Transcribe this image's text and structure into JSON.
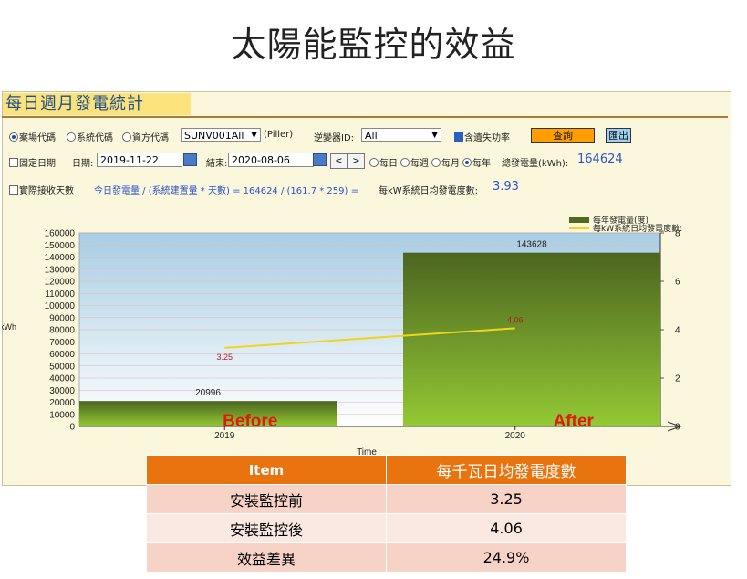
{
  "slide_title": "太陽能監控的效益",
  "panel_title": "每日週月發電統計",
  "controls": {
    "radio_station": "案場代碼",
    "radio_system": "系統代碼",
    "radio_owner": "資方代碼",
    "station_select": "SUNV001All",
    "station_note": "(Piller)",
    "inverter_label": "逆變器ID:",
    "inverter_select": "All",
    "include_loss_label": "含遺失功率",
    "query_button": "查詢",
    "export_button": "匯出",
    "fixed_date_label": "固定日期",
    "date_label": "日期:",
    "date_start": "2019-11-22",
    "date_end_label": "結束:",
    "date_end": "2020-08-06",
    "prev_button": "<",
    "next_button": ">",
    "period_daily": "每日",
    "period_weekly": "每週",
    "period_monthly": "每月",
    "period_yearly": "每年",
    "total_label": "總發電量(kWh):",
    "total_value": "164624",
    "actual_days_label": "實際接收天數",
    "formula_text": "今日發電量 / (系統建置量 * 天數) = 164624 / (161.7 * 259) =",
    "avg_label": "每kW系統日均發電度數:",
    "avg_value": "3.93"
  },
  "chart_data": {
    "type": "bar",
    "categories": [
      "2019",
      "2020"
    ],
    "series": [
      {
        "name": "每年發電量(度)",
        "type": "bar",
        "values": [
          20996,
          143628
        ]
      },
      {
        "name": "每kW系統日均發電度數:",
        "type": "line",
        "axis": "right",
        "values": [
          3.25,
          4.06
        ]
      }
    ],
    "xlabel": "Time",
    "ylabel": "kWh",
    "ylim": [
      0,
      160000
    ],
    "y_ticks": [
      0,
      10000,
      20000,
      30000,
      40000,
      50000,
      60000,
      70000,
      80000,
      90000,
      100000,
      110000,
      120000,
      130000,
      140000,
      150000,
      160000
    ],
    "y2lim": [
      0,
      8
    ],
    "y2_ticks": [
      0,
      2,
      4,
      6,
      8
    ],
    "annotations": [
      "Before",
      "After"
    ],
    "grid": true,
    "legend": "top-right",
    "colors": {
      "bar_top": "#4f6a22",
      "bar_bottom": "#8fc12f",
      "line": "#f3d31e",
      "plot_bg_top": "#aacde3",
      "annotation": "#e01a0a"
    }
  },
  "comparison_table": {
    "headers": [
      "Item",
      "每千瓦日均發電度數"
    ],
    "rows": [
      [
        "安裝監控前",
        "3.25"
      ],
      [
        "安裝監控後",
        "4.06"
      ],
      [
        "效益差異",
        "24.9%"
      ]
    ]
  }
}
